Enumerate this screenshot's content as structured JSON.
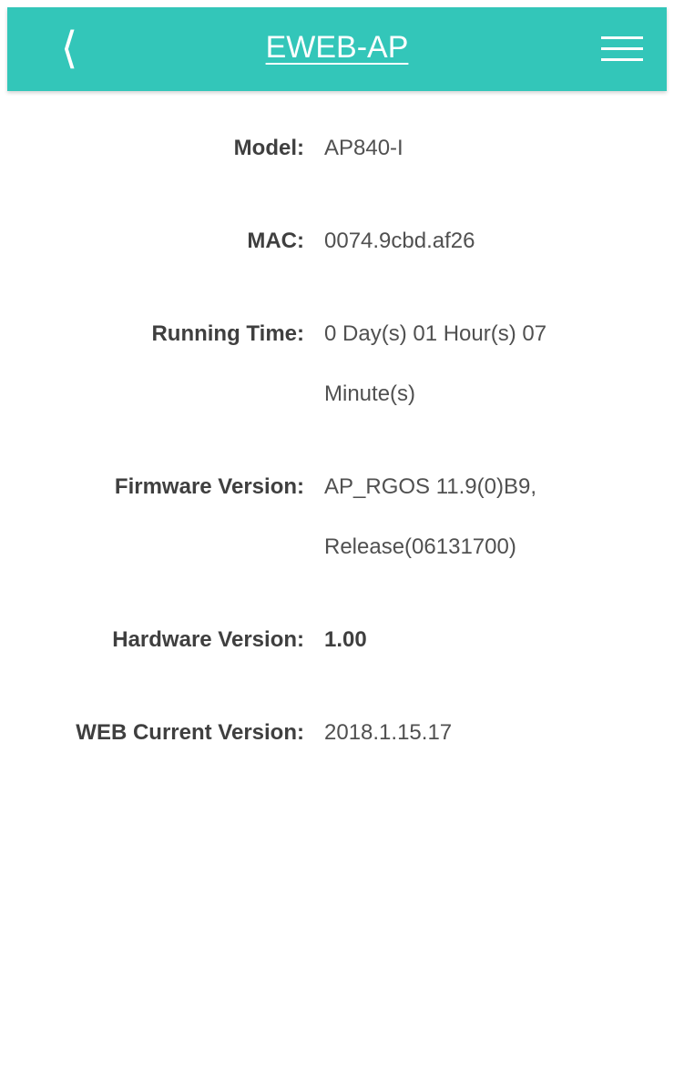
{
  "header": {
    "back_icon": "chevron-left-icon",
    "back_glyph": "⟨",
    "title": "EWEB-AP",
    "menu_icon": "hamburger-menu-icon",
    "bg_color": "#33c6b9"
  },
  "info": {
    "model": {
      "label": "Model:",
      "value": "AP840-I"
    },
    "mac": {
      "label": "MAC:",
      "value": "0074.9cbd.af26"
    },
    "running_time": {
      "label": "Running Time:",
      "value": "0 Day(s) 01 Hour(s) 07 Minute(s)"
    },
    "firmware_version": {
      "label": "Firmware Version:",
      "value": "AP_RGOS 11.9(0)B9, Release(06131700)"
    },
    "hardware_version": {
      "label": "Hardware Version:",
      "value": "1.00"
    },
    "web_current_version": {
      "label": "WEB Current Version:",
      "value": "2018.1.15.17"
    }
  }
}
